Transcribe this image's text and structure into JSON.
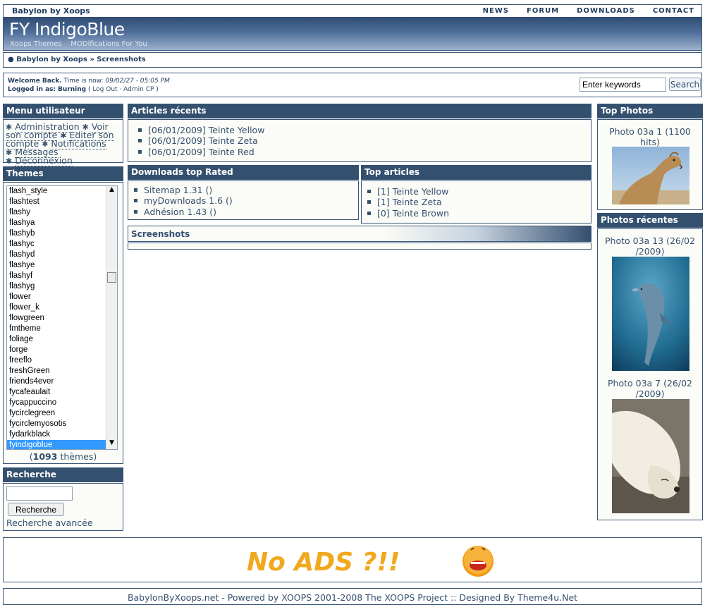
{
  "header": {
    "site_name": "Babylon by Xoops",
    "nav": [
      "NEWS",
      "FORUM",
      "DOWNLOADS",
      "CONTACT"
    ],
    "logo": "FY IndigoBlue",
    "tagline": "Xoops Themes    MODifications For You"
  },
  "breadcrumb": {
    "bullet": "●",
    "text": "Babylon by Xoops » Screenshots"
  },
  "welcome": {
    "welcome_label": "Welcome Back.",
    "time_label": "Time is now:",
    "time_value": "09/02/27 - 05:05 PM",
    "logged_label": "Logged in as:",
    "user": "Burning",
    "logout": "Log Out",
    "admin": "Admin CP",
    "search_placeholder": "Enter keywords",
    "search_button": "Search"
  },
  "user_menu": {
    "title": "Menu utilisateur",
    "items": [
      "Administration",
      "Voir son compte",
      "Editer son compte",
      "Notifications",
      "Messages",
      "Déconnexion"
    ]
  },
  "themes": {
    "title": "Themes",
    "items": [
      "flash_style",
      "flashtest",
      "flashy",
      "flashya",
      "flashyb",
      "flashyc",
      "flashyd",
      "flashye",
      "flashyf",
      "flashyg",
      "flower",
      "flower_k",
      "flowgreen",
      "fmtheme",
      "foliage",
      "forge",
      "freeflo",
      "freshGreen",
      "friends4ever",
      "fycafeaulait",
      "fycappuccino",
      "fycirclegreen",
      "fycirclemyosotis",
      "fydarkblack",
      "fyindigoblue"
    ],
    "selected": "fyindigoblue",
    "count": "1093",
    "count_suffix": "thèmes"
  },
  "recherche": {
    "title": "Recherche",
    "button": "Recherche",
    "advanced": "Recherche avancée"
  },
  "articles_recents": {
    "title": "Articles récents",
    "items": [
      "[06/01/2009] Teinte Yellow",
      "[06/01/2009] Teinte Zeta",
      "[06/01/2009] Teinte Red"
    ]
  },
  "downloads_top": {
    "title": "Downloads top Rated",
    "items": [
      "Sitemap 1.31 ()",
      "myDownloads 1.6 ()",
      "Adhésion 1.43 ()"
    ]
  },
  "top_articles": {
    "title": "Top articles",
    "items": [
      "[1] Teinte Yellow",
      "[1] Teinte Zeta",
      "[0] Teinte Brown"
    ]
  },
  "screenshots": {
    "title": "Screenshots"
  },
  "top_photos": {
    "title": "Top Photos",
    "photo_caption_1": "Photo 03a 1 (1100",
    "photo_caption_2": "hits)"
  },
  "recent_photos": {
    "title": "Photos récentes",
    "p1_line1": "Photo 03a 13 (26/02",
    "p1_line2": "/2009)",
    "p2_line1": "Photo 03a 7 (26/02",
    "p2_line2": "/2009)"
  },
  "ads": {
    "text": "No ADS ?!!"
  },
  "footer": {
    "text": "BabylonByXoops.net - Powered by XOOPS 2001-2008 The XOOPS Project :: Designed By Theme4u.Net"
  },
  "colors": {
    "header_bar": "#34506f",
    "accent_selected": "#3399ff",
    "ads_text": "#f2a81d"
  }
}
